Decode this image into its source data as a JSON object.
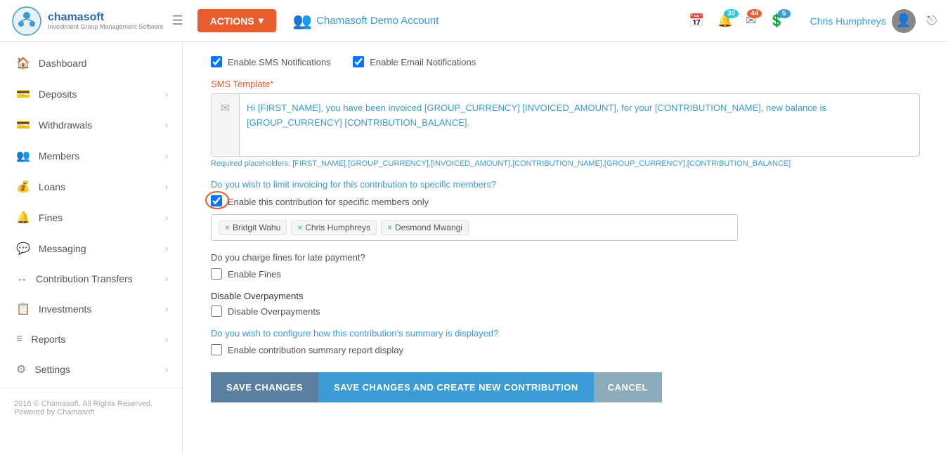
{
  "topNav": {
    "logoText": "chamasoft",
    "logoSubtext": "Investment Group Management Software",
    "actionsLabel": "ACTIONS",
    "accountName": "Chamasoft Demo Account",
    "notificationCount": "30",
    "messageCount": "44",
    "walletCount": "5",
    "userName": "Chris Humphreys"
  },
  "sidebar": {
    "items": [
      {
        "id": "dashboard",
        "label": "Dashboard",
        "icon": "🏠",
        "hasArrow": false
      },
      {
        "id": "deposits",
        "label": "Deposits",
        "icon": "💳",
        "hasArrow": true
      },
      {
        "id": "withdrawals",
        "label": "Withdrawals",
        "icon": "💳",
        "hasArrow": true
      },
      {
        "id": "members",
        "label": "Members",
        "icon": "👥",
        "hasArrow": true
      },
      {
        "id": "loans",
        "label": "Loans",
        "icon": "💰",
        "hasArrow": true
      },
      {
        "id": "fines",
        "label": "Fines",
        "icon": "🔔",
        "hasArrow": true
      },
      {
        "id": "messaging",
        "label": "Messaging",
        "icon": "💬",
        "hasArrow": true
      },
      {
        "id": "contribution-transfers",
        "label": "Contribution Transfers",
        "icon": "↔",
        "hasArrow": true
      },
      {
        "id": "investments",
        "label": "Investments",
        "icon": "📋",
        "hasArrow": true
      },
      {
        "id": "reports",
        "label": "Reports",
        "icon": "≡",
        "hasArrow": true
      },
      {
        "id": "settings",
        "label": "Settings",
        "icon": "⚙",
        "hasArrow": true
      }
    ],
    "footerText": "2016 © Chamasoft. All Rights Reserved. Powered by Chamasoft"
  },
  "form": {
    "smsNotificationLabel": "Enable SMS Notifications",
    "emailNotificationLabel": "Enable Email Notifications",
    "smsTemplateLabel": "SMS Template",
    "smsTemplateRequired": "*",
    "smsTemplateText": "Hi [FIRST_NAME], you have been invoiced [GROUP_CURRENCY] [INVOICED_AMOUNT], for your [CONTRIBUTION_NAME], new balance is [GROUP_CURRENCY] [CONTRIBUTION_BALANCE].",
    "placeholderHintLabel": "Required placeholders:",
    "placeholderHintValue": "[FIRST_NAME],[GROUP_CURRENCY],[INVOICED_AMOUNT],[CONTRIBUTION_NAME],[GROUP_CURRENCY],[CONTRIBUTION_BALANCE]",
    "limitInvoicingQuestion": "Do you wish to",
    "limitInvoicingLink": "limit invoicing for this contribution to specific members?",
    "specificMembersLabel": "Enable this contribution for specific members only",
    "members": [
      {
        "name": "Bridgit Wahu"
      },
      {
        "name": "Chris Humphreys"
      },
      {
        "name": "Desmond Mwangi"
      }
    ],
    "finesQuestion": "Do you charge fines for late payment?",
    "finesLabel": "Enable Fines",
    "disableOverpaymentsTitle": "Disable Overpayments",
    "disableOverpaymentsLabel": "Disable Overpayments",
    "summaryQuestion": "Do you wish to",
    "summaryLink": "configure how this contribution's summary is displayed?",
    "summaryLabel": "Enable contribution summary report display",
    "buttons": {
      "saveChanges": "SAVE CHANGES",
      "saveAndCreate": "SAVE CHANGES AND CREATE NEW CONTRIBUTION",
      "cancel": "CANCEL"
    }
  }
}
